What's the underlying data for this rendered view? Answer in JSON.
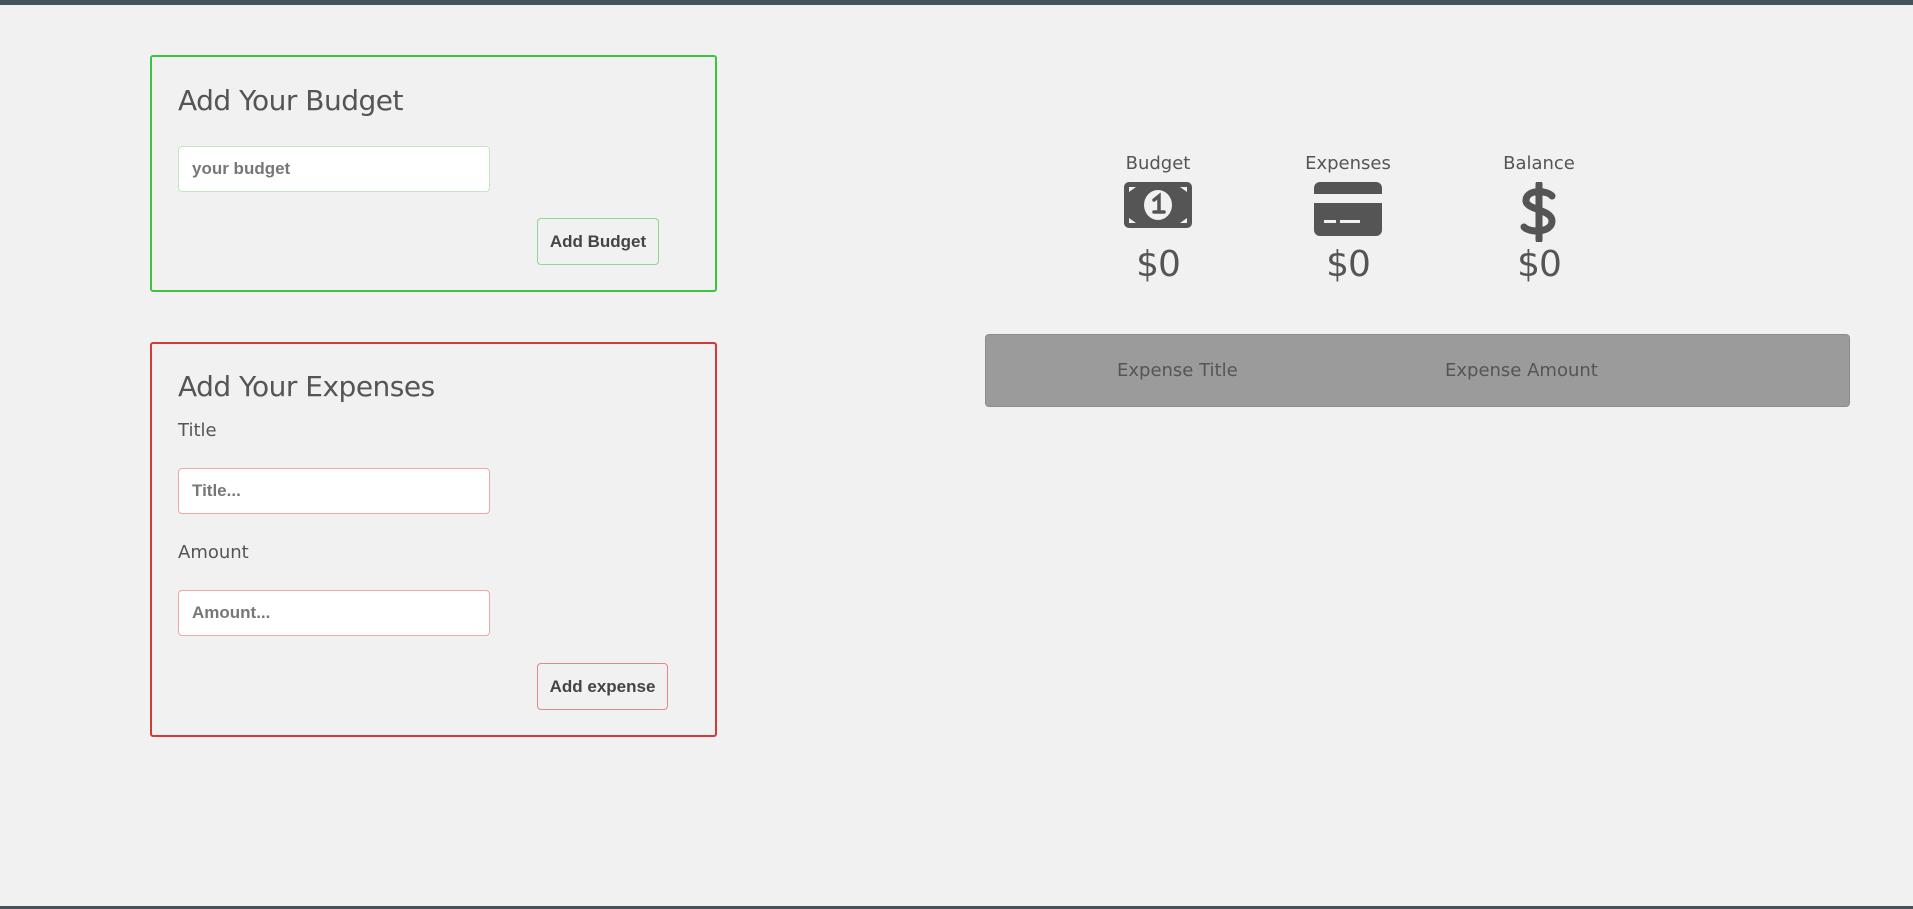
{
  "budget_form": {
    "title": "Add Your Budget",
    "input_placeholder": "your budget",
    "button_label": "Add Budget"
  },
  "expense_form": {
    "title": "Add Your Expenses",
    "title_label": "Title",
    "title_placeholder": "Title...",
    "amount_label": "Amount",
    "amount_placeholder": "Amount...",
    "button_label": "Add expense"
  },
  "summary": {
    "budget": {
      "label": "Budget",
      "icon": "money-bill-icon",
      "value": "$0"
    },
    "expenses": {
      "label": "Expenses",
      "icon": "credit-card-icon",
      "value": "$0"
    },
    "balance": {
      "label": "Balance",
      "icon": "dollar-sign-icon",
      "value": "$0"
    }
  },
  "expense_table": {
    "columns": [
      "Expense Title",
      "Expense Amount"
    ]
  },
  "colors": {
    "budget_accent": "#3dc43d",
    "expense_accent": "#d33a3a",
    "icon": "#555555",
    "table_header": "#9b9b9b",
    "frame_bar": "#45535d"
  }
}
